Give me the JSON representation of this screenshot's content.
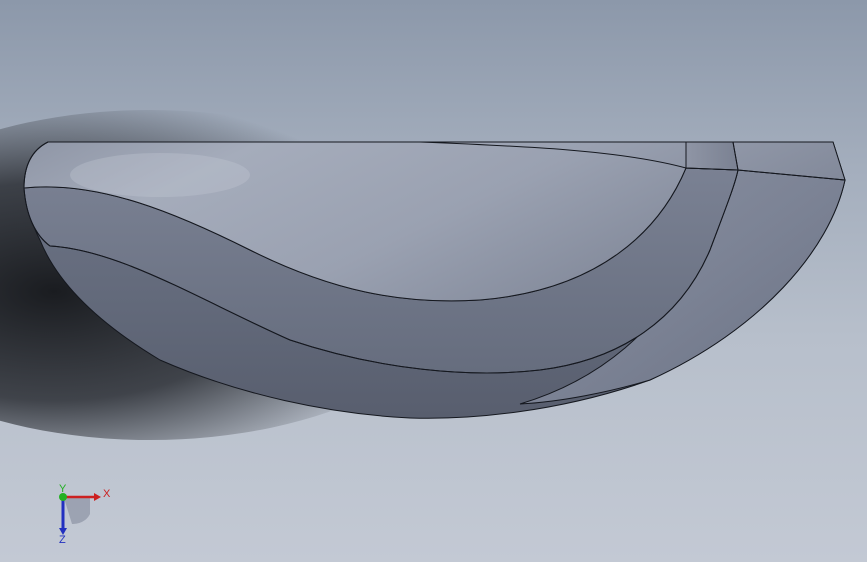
{
  "viewport": {
    "background_top": "#8c98aa",
    "background_bottom": "#c3c9d4"
  },
  "model": {
    "name": "curved-shell-part",
    "face_color": "#7d8496",
    "edge_color": "#15181f"
  },
  "triad": {
    "x_label": "X",
    "y_label": "Y",
    "z_label": "Z",
    "x_color": "#cc2020",
    "y_color": "#22b022",
    "z_color": "#2230c0"
  }
}
